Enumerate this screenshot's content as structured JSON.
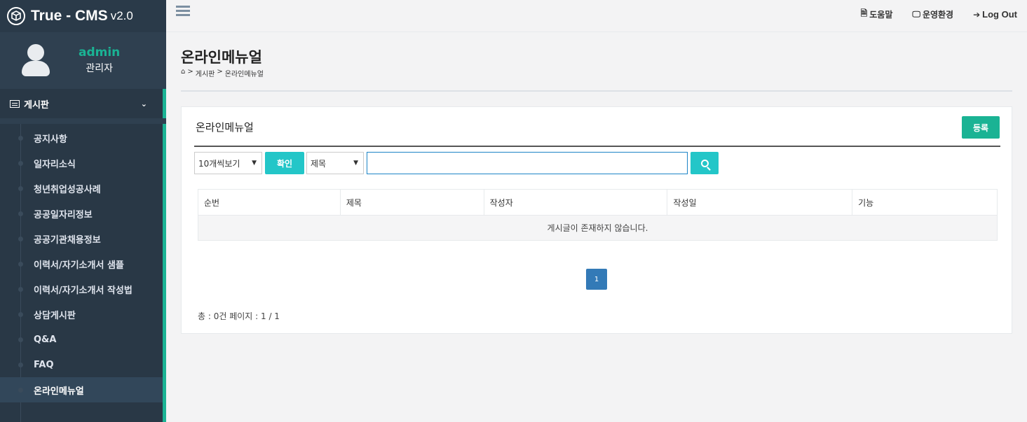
{
  "app": {
    "title": "True - CMS",
    "version": "v2.0"
  },
  "user": {
    "name": "admin",
    "role": "관리자"
  },
  "sidebar": {
    "section_label": "게시판",
    "items": [
      {
        "label": "공지사항"
      },
      {
        "label": "일자리소식"
      },
      {
        "label": "청년취업성공사례"
      },
      {
        "label": "공공일자리정보"
      },
      {
        "label": "공공기관채용정보"
      },
      {
        "label": "이력서/자기소개서 샘플"
      },
      {
        "label": "이력서/자기소개서 작성법"
      },
      {
        "label": "상담게시판"
      },
      {
        "label": "Q&A"
      },
      {
        "label": "FAQ"
      },
      {
        "label": "온라인메뉴얼",
        "active": true
      }
    ]
  },
  "topbar": {
    "help": "도움말",
    "settings": "운영환경",
    "logout": "Log Out"
  },
  "page": {
    "title": "온라인메뉴얼",
    "breadcrumb": {
      "sep1": ">",
      "board": "게시판",
      "sep2": ">",
      "current": "온라인메뉴얼"
    }
  },
  "panel": {
    "title": "온라인메뉴얼",
    "register_label": "등록",
    "page_size": "10개씩보기",
    "confirm_label": "확인",
    "search_field": "제목",
    "search_value": "",
    "table": {
      "columns": [
        "순번",
        "제목",
        "작성자",
        "작성일",
        "기능"
      ],
      "empty_message": "게시글이 존재하지 않습니다."
    },
    "pagination": {
      "current": "1"
    },
    "summary": "총 : 0건 페이지 : 1 / 1"
  },
  "colors": {
    "sidebar_bg": "#2f4050",
    "accent": "#1ab394",
    "info": "#23c6c8",
    "primary": "#337ab7"
  }
}
